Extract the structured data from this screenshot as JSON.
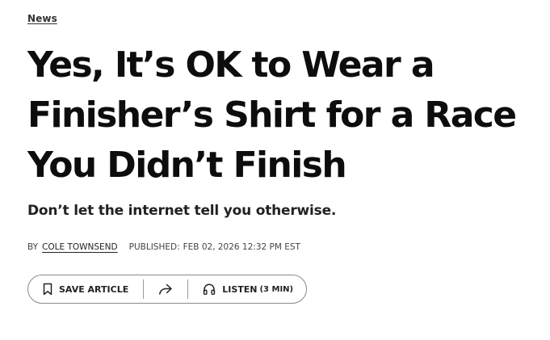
{
  "article": {
    "category": "News",
    "headline_lines": [
      "Yes, It’s OK to Wear a",
      "Finisher’s Shirt for a Race",
      "You Didn’t Finish"
    ],
    "dek": "Don’t let the internet tell you otherwise.",
    "byline": {
      "prefix": "BY",
      "author": "COLE TOWNSEND",
      "published_label": "PUBLISHED:",
      "published_date": "FEB 02, 2026 12:32 PM EST"
    }
  },
  "actions": {
    "save_label": "SAVE ARTICLE",
    "listen_label": "LISTEN",
    "listen_duration": "(3 MIN)",
    "icons": {
      "save": "bookmark-icon",
      "share": "share-icon",
      "listen": "headphones-icon"
    }
  }
}
